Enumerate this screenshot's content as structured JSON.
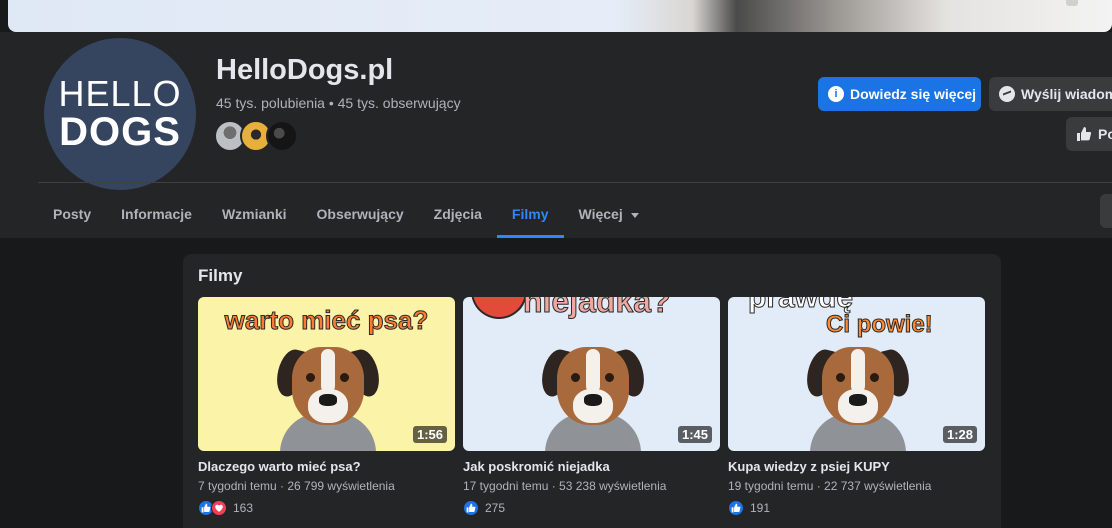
{
  "avatar": {
    "line1": "HELLO",
    "line2": "DOGS"
  },
  "page": {
    "name": "HelloDogs.pl",
    "stats": "45 tys. polubienia • 45 tys. obserwujący"
  },
  "actions": {
    "learn_more": "Dowiedz się więcej",
    "send_message": "Wyślij wiadom",
    "like": "Po"
  },
  "tabs": [
    {
      "label": "Posty"
    },
    {
      "label": "Informacje"
    },
    {
      "label": "Wzmianki"
    },
    {
      "label": "Obserwujący"
    },
    {
      "label": "Zdjęcia"
    },
    {
      "label": "Filmy"
    },
    {
      "label": "Więcej"
    }
  ],
  "section": {
    "title": "Filmy"
  },
  "videos": [
    {
      "thumb_text": "warto mieć psa?",
      "duration": "1:56",
      "title": "Dlaczego warto mieć psa?",
      "meta": "7 tygodni temu · 26 799 wyświetlenia",
      "reactions": "163"
    },
    {
      "thumb_text": "niejadka?",
      "duration": "1:45",
      "title": "Jak poskromić niejadka",
      "meta": "17 tygodni temu · 53 238 wyświetlenia",
      "reactions": "275"
    },
    {
      "thumb_text_1": "prawdę",
      "thumb_text_2": "Ci powie!",
      "duration": "1:28",
      "title": "Kupa wiedzy z psiej KUPY",
      "meta": "19 tygodni temu · 22 737 wyświetlenia",
      "reactions": "191"
    }
  ],
  "colors": {
    "accent": "#2d88ff",
    "primary_button": "#1b74e4",
    "background": "#18191a",
    "surface": "#242526"
  }
}
